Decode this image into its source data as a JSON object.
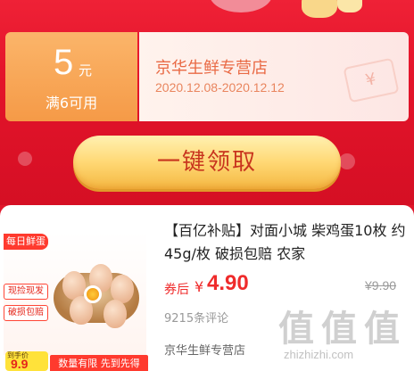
{
  "coupon": {
    "amount": "5",
    "unit": "元",
    "condition": "满6可用",
    "shop_name": "京华生鲜专营店",
    "valid_dates": "2020.12.08-2020.12.12",
    "rmb_symbol": "¥"
  },
  "cta": {
    "label": "一键领取"
  },
  "product": {
    "thumb": {
      "badge": "每日鲜蛋",
      "tag1": "现捡现发",
      "tag2": "破损包赔",
      "price_prefix": "到手价",
      "price_value": "9.9",
      "limit_text": "数量有限 先到先得"
    },
    "title": "【百亿补贴】对面小城 柴鸡蛋10枚 约45g/枚 破损包赔 农家",
    "price_label": "券后",
    "currency": "¥",
    "price": "4.90",
    "original_price": "¥9.90",
    "reviews": "9215条评论",
    "shop": "京华生鲜专营店"
  },
  "watermark": {
    "glyphs": [
      "值",
      "值",
      "值"
    ],
    "domain": "zhizhizhi.com"
  },
  "colors": {
    "background_red": "#e0162a",
    "coupon_orange": "#f59a47",
    "cta_gold": "#ffd874",
    "price_red": "#ef2b2b"
  }
}
